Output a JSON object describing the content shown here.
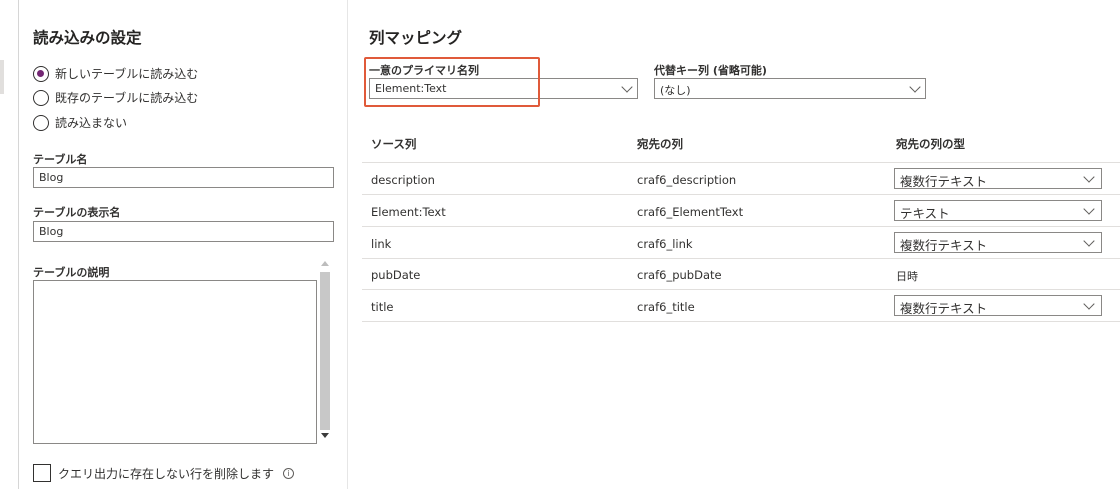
{
  "load_settings": {
    "title": "読み込みの設定",
    "options": [
      {
        "label": "新しいテーブルに読み込む",
        "selected": true
      },
      {
        "label": "既存のテーブルに読み込む",
        "selected": false
      },
      {
        "label": "読み込まない",
        "selected": false
      }
    ],
    "table_name_label": "テーブル名",
    "table_name_value": "Blog",
    "display_name_label": "テーブルの表示名",
    "display_name_value": "Blog",
    "description_label": "テーブルの説明",
    "description_value": "",
    "delete_rows_label": "クエリ出力に存在しない行を削除します",
    "info_icon": "info-icon"
  },
  "mapping": {
    "title": "列マッピング",
    "primary_name_label": "一意のプライマリ名列",
    "primary_name_value": "Element:Text",
    "alt_key_label": "代替キー列 (省略可能)",
    "alt_key_value": "(なし)",
    "columns": {
      "source": "ソース列",
      "dest": "宛先の列",
      "type": "宛先の列の型"
    },
    "rows": [
      {
        "source": "description",
        "dest": "craf6_description",
        "type": "複数行テキスト",
        "editable": true
      },
      {
        "source": "Element:Text",
        "dest": "craf6_ElementText",
        "type": "テキスト",
        "editable": true
      },
      {
        "source": "link",
        "dest": "craf6_link",
        "type": "複数行テキスト",
        "editable": true
      },
      {
        "source": "pubDate",
        "dest": "craf6_pubDate",
        "type": "日時",
        "editable": false
      },
      {
        "source": "title",
        "dest": "craf6_title",
        "type": "複数行テキスト",
        "editable": true
      }
    ]
  },
  "colors": {
    "accent": "#742774",
    "highlight": "#e05a3a",
    "border": "#8a8886"
  }
}
